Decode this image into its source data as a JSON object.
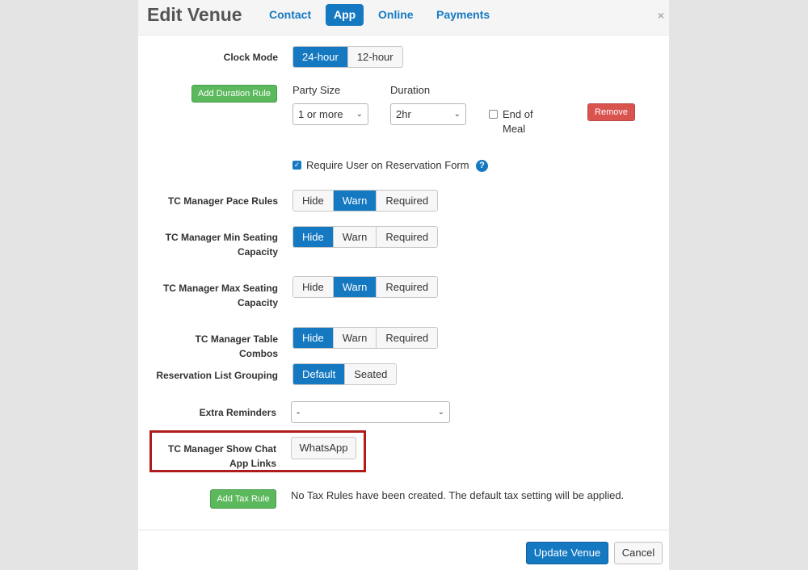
{
  "header": {
    "title": "Edit Venue",
    "tabs": [
      {
        "label": "Contact",
        "active": false
      },
      {
        "label": "App",
        "active": true
      },
      {
        "label": "Online",
        "active": false
      },
      {
        "label": "Payments",
        "active": false
      }
    ],
    "close_icon": "×"
  },
  "clock_mode": {
    "label": "Clock Mode",
    "options": [
      "24-hour",
      "12-hour"
    ],
    "selected": "24-hour"
  },
  "duration_rule": {
    "add_button": "Add Duration Rule",
    "party_size_label": "Party Size",
    "party_size_value": "1 or more",
    "duration_label": "Duration",
    "duration_value": "2hr",
    "end_of_meal_label": "End of Meal",
    "end_of_meal_checked": false,
    "remove_button": "Remove"
  },
  "require_user": {
    "label": "Require User on Reservation Form",
    "checked": true,
    "help_icon": "?"
  },
  "pace_rules": {
    "label": "TC Manager Pace Rules",
    "options": [
      "Hide",
      "Warn",
      "Required"
    ],
    "selected": "Warn"
  },
  "min_seating": {
    "label": "TC Manager Min Seating Capacity",
    "options": [
      "Hide",
      "Warn",
      "Required"
    ],
    "selected": "Hide"
  },
  "max_seating": {
    "label": "TC Manager Max Seating Capacity",
    "options": [
      "Hide",
      "Warn",
      "Required"
    ],
    "selected": "Warn"
  },
  "table_combos": {
    "label": "TC Manager Table Combos",
    "options": [
      "Hide",
      "Warn",
      "Required"
    ],
    "selected": "Hide"
  },
  "list_grouping": {
    "label": "Reservation List Grouping",
    "options": [
      "Default",
      "Seated"
    ],
    "selected": "Default"
  },
  "extra_reminders": {
    "label": "Extra Reminders",
    "value": "-"
  },
  "chat_app": {
    "label": "TC Manager Show Chat App Links",
    "button": "WhatsApp"
  },
  "tax": {
    "add_button": "Add Tax Rule",
    "message": "No Tax Rules have been created. The default tax setting will be applied."
  },
  "footer": {
    "update_button": "Update Venue",
    "cancel_button": "Cancel"
  },
  "colors": {
    "accent": "#1579c2",
    "success": "#5cb85c",
    "danger": "#d9534f",
    "highlight": "#b01c1c"
  }
}
